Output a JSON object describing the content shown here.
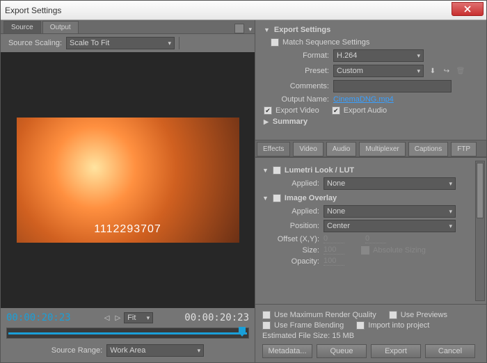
{
  "window": {
    "title": "Export Settings"
  },
  "left": {
    "tabs": {
      "source": "Source",
      "output": "Output"
    },
    "sourceScaling": {
      "label": "Source Scaling:",
      "value": "Scale To Fit"
    },
    "watermark": "1112293707",
    "timecode_in": "00:00:20:23",
    "timecode_out": "00:00:20:23",
    "fit": "Fit",
    "sourceRange": {
      "label": "Source Range:",
      "value": "Work Area"
    }
  },
  "export": {
    "header": "Export Settings",
    "matchSeq": "Match Sequence Settings",
    "format": {
      "label": "Format:",
      "value": "H.264"
    },
    "preset": {
      "label": "Preset:",
      "value": "Custom"
    },
    "comments": {
      "label": "Comments:"
    },
    "outputName": {
      "label": "Output Name:",
      "value": "CinemaDNG.mp4"
    },
    "exportVideo": "Export Video",
    "exportAudio": "Export Audio",
    "summary": "Summary"
  },
  "subtabs": [
    "Effects",
    "Video",
    "Audio",
    "Multiplexer",
    "Captions",
    "FTP"
  ],
  "lumetri": {
    "header": "Lumetri Look / LUT",
    "applied": {
      "label": "Applied:",
      "value": "None"
    }
  },
  "overlay": {
    "header": "Image Overlay",
    "applied": {
      "label": "Applied:",
      "value": "None"
    },
    "position": {
      "label": "Position:",
      "value": "Center"
    },
    "offset": {
      "label": "Offset (X,Y):",
      "x": "0",
      "y": "0"
    },
    "size": {
      "label": "Size:",
      "value": "100",
      "abs": "Absolute Sizing"
    },
    "opacity": {
      "label": "Opacity:",
      "value": "100"
    }
  },
  "footer": {
    "maxQuality": "Use Maximum Render Quality",
    "previews": "Use Previews",
    "frameBlend": "Use Frame Blending",
    "import": "Import into project",
    "estimated": "Estimated File Size:  15 MB",
    "buttons": {
      "metadata": "Metadata...",
      "queue": "Queue",
      "export": "Export",
      "cancel": "Cancel"
    }
  }
}
